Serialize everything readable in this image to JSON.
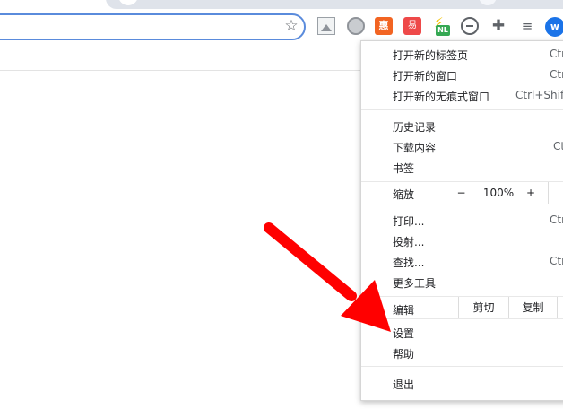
{
  "browser": {
    "avatar_initial": "w",
    "extensions": {
      "ext3_text": "惠",
      "ext4_text": "易",
      "ext5_badge": "NL"
    }
  },
  "menu": {
    "group1": [
      {
        "label": "打开新的标签页",
        "shortcut": "Ctrl"
      },
      {
        "label": "打开新的窗口",
        "shortcut": "Ctrl"
      },
      {
        "label": "打开新的无痕式窗口",
        "shortcut": "Ctrl+Shift"
      }
    ],
    "group2": [
      {
        "label": "历史记录",
        "shortcut": ""
      },
      {
        "label": "下载内容",
        "shortcut": "Ct"
      },
      {
        "label": "书签",
        "shortcut": ""
      }
    ],
    "zoom": {
      "label": "缩放",
      "minus": "−",
      "value": "100%",
      "plus": "+"
    },
    "group3": [
      {
        "label": "打印...",
        "shortcut": "Ctr"
      },
      {
        "label": "投射...",
        "shortcut": ""
      },
      {
        "label": "查找...",
        "shortcut": "Ctr"
      },
      {
        "label": "更多工具",
        "shortcut": ""
      }
    ],
    "edit": {
      "label": "编辑",
      "cut": "剪切",
      "copy": "复制"
    },
    "group4": [
      {
        "label": "设置"
      },
      {
        "label": "帮助"
      }
    ],
    "exit": {
      "label": "退出"
    }
  },
  "annotation": {
    "arrow_color": "#ff0000"
  }
}
